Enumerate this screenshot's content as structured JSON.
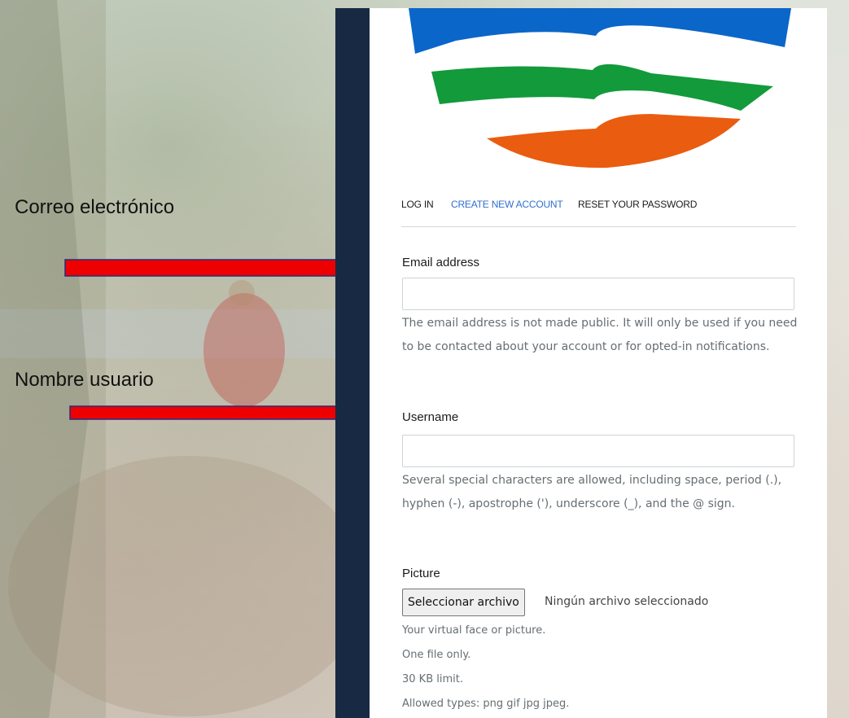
{
  "annotations": {
    "correo_label": "Correo electrónico",
    "nombre_label": "Nombre usuario"
  },
  "nav": {
    "login": "LOG IN",
    "create": "CREATE NEW ACCOUNT",
    "reset": "RESET YOUR PASSWORD"
  },
  "form": {
    "email": {
      "label": "Email address",
      "value": "",
      "description": "The email address is not made public. It will only be used if you need to be contacted about your account or for opted-in notifications."
    },
    "username": {
      "label": "Username",
      "value": "",
      "description": "Several special characters are allowed, including space, period (.), hyphen (-), apostrophe ('), underscore (_), and the @ sign."
    },
    "picture": {
      "label": "Picture",
      "button": "Seleccionar archivo",
      "status": "Ningún archivo seleccionado",
      "help_1": "Your virtual face or picture.",
      "help_2": "One file only.",
      "help_3": "30 KB limit.",
      "help_4": "Allowed types: png gif jpg jpeg."
    }
  },
  "colors": {
    "frame": "#182a43",
    "link": "#2f6fd1",
    "logo_blue": "#0a66c9",
    "logo_green": "#129a3b",
    "logo_orange": "#ea5c0f",
    "arrow_red": "#ee0000"
  }
}
